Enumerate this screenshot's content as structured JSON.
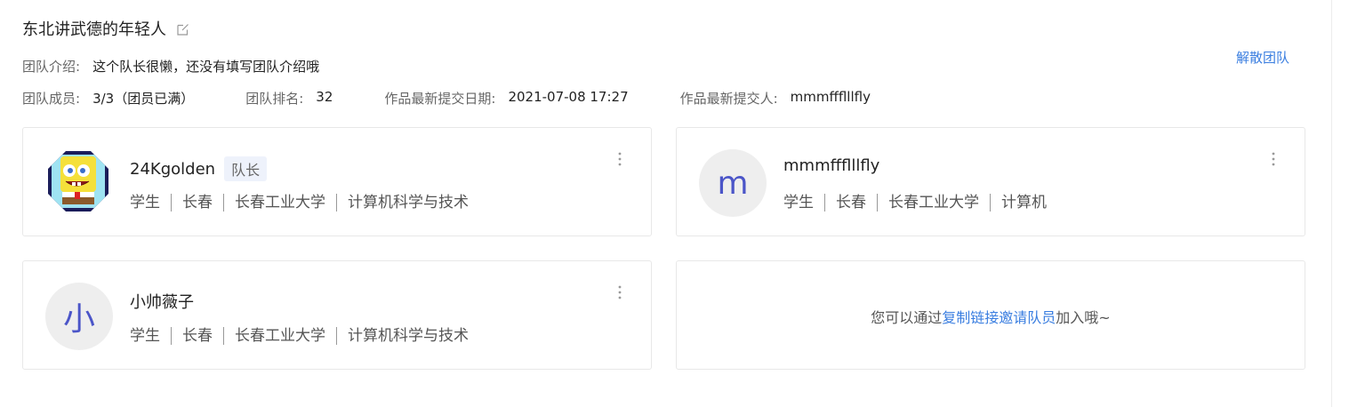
{
  "team": {
    "name": "东北讲武德的年轻人",
    "intro_label": "团队介绍:",
    "intro_value": "这个队长很懒，还没有填写团队介绍哦",
    "members_label": "团队成员:",
    "members_value": "3/3（团员已满）",
    "rank_label": "团队排名:",
    "rank_value": "32",
    "latest_date_label": "作品最新提交日期:",
    "latest_date_value": "2021-07-08 17:27",
    "latest_submitter_label": "作品最新提交人:",
    "latest_submitter_value": "mmmffflllfly",
    "dissolve_label": "解散团队"
  },
  "members": [
    {
      "name": "24Kgolden",
      "role": "队长",
      "avatar_text": "",
      "avatar_icon": "spongebob-avatar",
      "tags": [
        "学生",
        "长春",
        "长春工业大学",
        "计算机科学与技术"
      ]
    },
    {
      "name": "mmmffflllfly",
      "role": "",
      "avatar_text": "m",
      "tags": [
        "学生",
        "长春",
        "长春工业大学",
        "计算机"
      ]
    },
    {
      "name": "小帅薇子",
      "role": "",
      "avatar_text": "小",
      "tags": [
        "学生",
        "长春",
        "长春工业大学",
        "计算机科学与技术"
      ]
    }
  ],
  "invite": {
    "prefix": "您可以通过",
    "link": "复制链接邀请队员",
    "suffix": "加入哦~"
  },
  "colors": {
    "accent": "#3a7ee0",
    "avatar_letter": "#4b55c8"
  }
}
